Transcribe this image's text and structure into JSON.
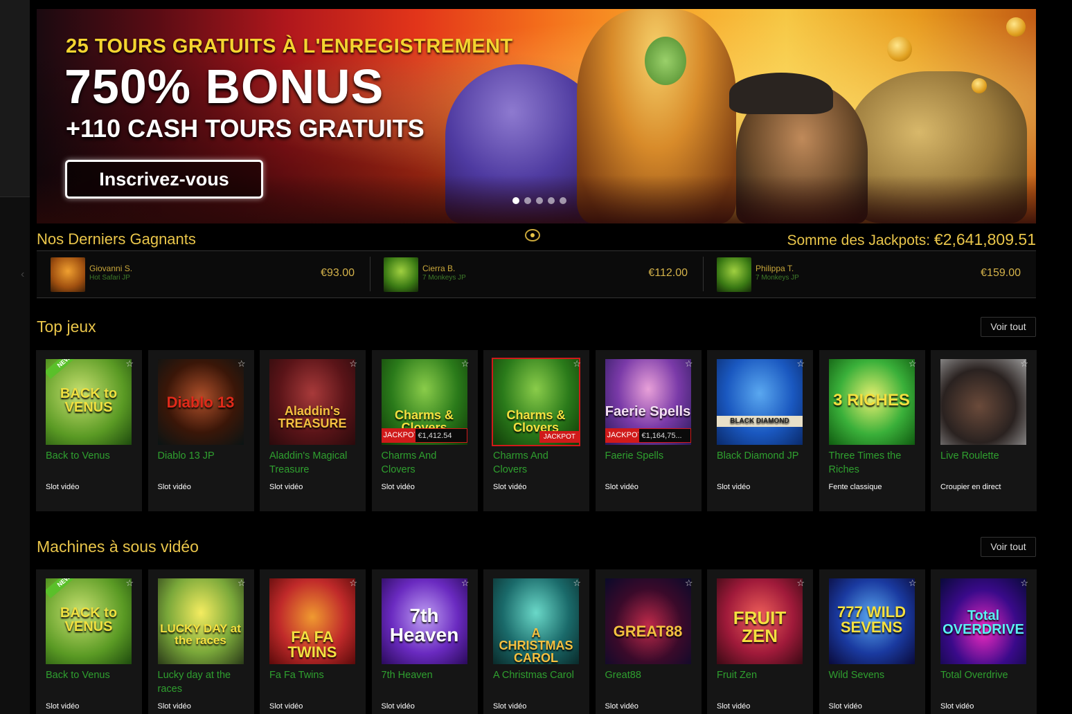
{
  "banner": {
    "line1": "25 TOURS GRATUITS À L'ENREGISTREMENT",
    "line2": "750% BONUS",
    "line3": "+110 CASH TOURS GRATUITS",
    "cta": "Inscrivez-vous",
    "slides": 5,
    "active_slide": 1
  },
  "winners": {
    "title": "Nos Derniers Gagnants",
    "jackpot_label": "Somme des Jackpots:",
    "jackpot_value": "€2,641,809.51",
    "items": [
      {
        "name": "Giovanni S.",
        "game": "Hot Safari JP",
        "amount": "€93.00",
        "thumb": "hot-safari"
      },
      {
        "name": "Cierra B.",
        "game": "7 Monkeys JP",
        "amount": "€112.00",
        "thumb": "7-monkeys"
      },
      {
        "name": "Philippa T.",
        "game": "7 Monkeys JP",
        "amount": "€159.00",
        "thumb": "7-monkeys"
      }
    ]
  },
  "top_games": {
    "title": "Top jeux",
    "see_all": "Voir tout",
    "cards": [
      {
        "title": "Back to Venus",
        "category": "Slot vidéo",
        "art": "BACK to VENUS",
        "badge": "NEW"
      },
      {
        "title": "Diablo 13 JP",
        "category": "Slot vidéo",
        "art": "Diablo 13"
      },
      {
        "title": "Aladdin's Magical Treasure",
        "category": "Slot vidéo",
        "art": "Aladdin's TREASURE"
      },
      {
        "title": "Charms And Clovers",
        "category": "Slot vidéo",
        "art": "Charms & Clovers",
        "jackpot_label": "JACKPOT",
        "jackpot_value": "€1,412.54"
      },
      {
        "title": "Charms And Clovers",
        "category": "Slot vidéo",
        "art": "Charms & Clovers",
        "jackpot_tag": "JACKPOT"
      },
      {
        "title": "Faerie Spells",
        "category": "Slot vidéo",
        "art": "Faerie Spells",
        "jackpot_label": "JACKPOT",
        "jackpot_value": "€1,164,75..."
      },
      {
        "title": "Black Diamond JP",
        "category": "Slot vidéo",
        "art": "BLACK DIAMOND"
      },
      {
        "title": "Three Times the Riches",
        "category": "Fente classique",
        "art": "3 RICHES"
      },
      {
        "title": "Live Roulette",
        "category": "Croupier en direct",
        "art": ""
      }
    ]
  },
  "video_slots": {
    "title": "Machines à sous vidéo",
    "see_all": "Voir tout",
    "cards": [
      {
        "title": "Back to Venus",
        "category": "Slot vidéo",
        "art": "BACK to VENUS",
        "badge": "NEW"
      },
      {
        "title": "Lucky day at the races",
        "category": "Slot vidéo",
        "art": "LUCKY DAY at the races"
      },
      {
        "title": "Fa Fa Twins",
        "category": "Slot vidéo",
        "art": "FA FA TWINS"
      },
      {
        "title": "7th Heaven",
        "category": "Slot vidéo",
        "art": "7th Heaven"
      },
      {
        "title": "A Christmas Carol",
        "category": "Slot vidéo",
        "art": "A CHRISTMAS CAROL"
      },
      {
        "title": "Great88",
        "category": "Slot vidéo",
        "art": "GREAT88"
      },
      {
        "title": "Fruit Zen",
        "category": "Slot vidéo",
        "art": "FRUIT ZEN"
      },
      {
        "title": "Wild Sevens",
        "category": "Slot vidéo",
        "art": "777 WILD SEVENS"
      },
      {
        "title": "Total Overdrive",
        "category": "Slot vidéo",
        "art": "Total OVERDRIVE"
      }
    ]
  },
  "colors": {
    "gold": "#e9c54a",
    "green": "#2fa02f",
    "jackpot_red": "#d01a1a"
  }
}
